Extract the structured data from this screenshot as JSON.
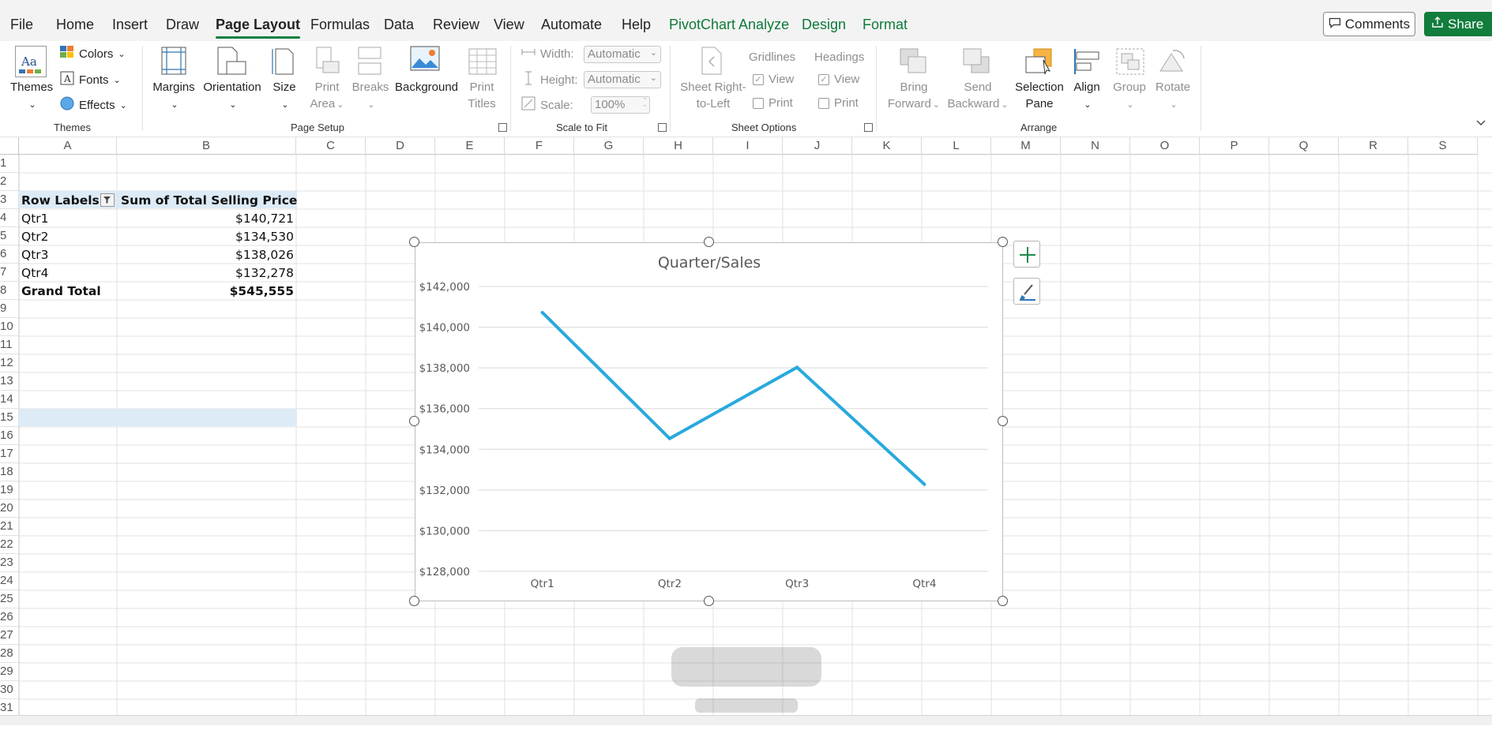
{
  "menu": {
    "tabs": [
      {
        "label": "File"
      },
      {
        "label": "Home"
      },
      {
        "label": "Insert"
      },
      {
        "label": "Draw"
      },
      {
        "label": "Page Layout"
      },
      {
        "label": "Formulas"
      },
      {
        "label": "Data"
      },
      {
        "label": "Review"
      },
      {
        "label": "View"
      },
      {
        "label": "Automate"
      },
      {
        "label": "Help"
      },
      {
        "label": "PivotChart Analyze"
      },
      {
        "label": "Design"
      },
      {
        "label": "Format"
      }
    ],
    "comments_label": "Comments",
    "share_label": "Share"
  },
  "ribbon": {
    "themes": {
      "themes_label": "Themes",
      "colors_label": "Colors",
      "fonts_label": "Fonts",
      "effects_label": "Effects",
      "group_label": "Themes"
    },
    "page_setup": {
      "margins": "Margins",
      "orientation": "Orientation",
      "size": "Size",
      "print_area_1": "Print",
      "print_area_2": "Area",
      "breaks": "Breaks",
      "background": "Background",
      "print_titles_1": "Print",
      "print_titles_2": "Titles",
      "group_label": "Page Setup"
    },
    "scale": {
      "width_label": "Width:",
      "width_value": "Automatic",
      "height_label": "Height:",
      "height_value": "Automatic",
      "scale_label": "Scale:",
      "scale_value": "100%",
      "group_label": "Scale to Fit"
    },
    "sheet_options": {
      "rtl_1": "Sheet Right-",
      "rtl_2": "to-Left",
      "gridlines": "Gridlines",
      "headings": "Headings",
      "view": "View",
      "print": "Print",
      "group_label": "Sheet Options"
    },
    "arrange": {
      "bring_1": "Bring",
      "bring_2": "Forward",
      "send_1": "Send",
      "send_2": "Backward",
      "selection_1": "Selection",
      "selection_2": "Pane",
      "align": "Align",
      "group": "Group",
      "rotate": "Rotate",
      "group_label": "Arrange"
    }
  },
  "sheet": {
    "columns": [
      "A",
      "B",
      "C",
      "D",
      "E",
      "F",
      "G",
      "H",
      "I",
      "J",
      "K",
      "L",
      "M",
      "N",
      "O",
      "P",
      "Q",
      "R",
      "S"
    ],
    "rows": [
      "1",
      "2",
      "3",
      "4",
      "5",
      "6",
      "7",
      "8",
      "9",
      "10",
      "11",
      "12",
      "13",
      "14",
      "15",
      "16",
      "17",
      "18",
      "19",
      "20",
      "21",
      "22",
      "23",
      "24",
      "25",
      "26",
      "27",
      "28",
      "29",
      "30",
      "31"
    ],
    "pivot": {
      "header_labels": "Row Labels",
      "header_values": "Sum of Total Selling Price",
      "rows": [
        {
          "label": "Qtr1",
          "value": "$140,721"
        },
        {
          "label": "Qtr2",
          "value": "$134,530"
        },
        {
          "label": "Qtr3",
          "value": "$138,026"
        },
        {
          "label": "Qtr4",
          "value": "$132,278"
        }
      ],
      "total_label": "Grand Total",
      "total_value": "$545,555"
    }
  },
  "chart_data": {
    "type": "line",
    "title": "Quarter/Sales",
    "categories": [
      "Qtr1",
      "Qtr2",
      "Qtr3",
      "Qtr4"
    ],
    "series": [
      {
        "values": [
          140721,
          134530,
          138026,
          132278
        ],
        "color": "#29a9dd"
      }
    ],
    "ylim": [
      128000,
      142000
    ],
    "yticks": [
      128000,
      130000,
      132000,
      134000,
      136000,
      138000,
      140000,
      142000
    ],
    "ytick_labels": [
      "$128,000",
      "$130,000",
      "$132,000",
      "$134,000",
      "$136,000",
      "$138,000",
      "$140,000",
      "$142,000"
    ],
    "grid": true,
    "xlabel": "",
    "ylabel": ""
  },
  "colors": {
    "accent": "#117e3f",
    "pivot_header": "#ddebf7",
    "line": "#29a9dd"
  }
}
